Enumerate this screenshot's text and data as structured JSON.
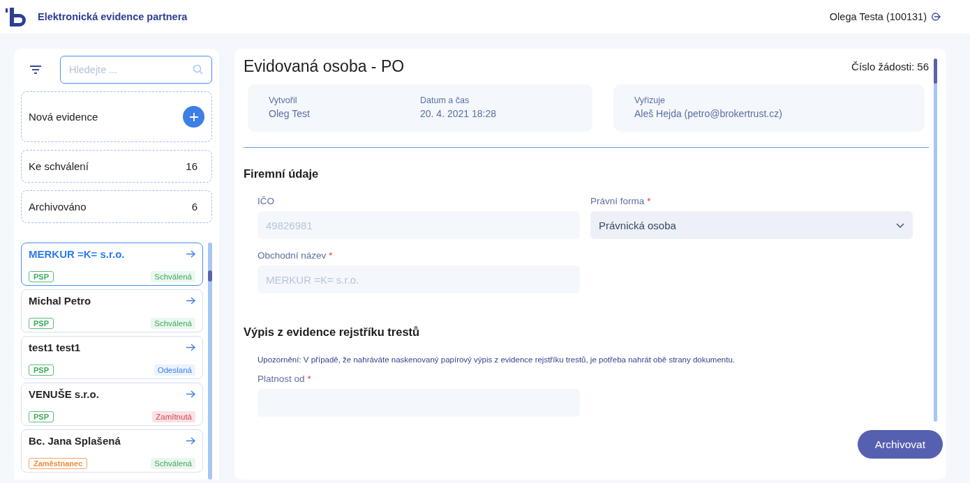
{
  "header": {
    "app_title": "Elektronická evidence partnera",
    "user": "Olega Testa (100131)"
  },
  "sidebar": {
    "search": {
      "placeholder": "Hledejte ..."
    },
    "new_entry": {
      "label": "Nová evidence"
    },
    "counters": [
      {
        "label": "Ke schválení",
        "count": "16"
      },
      {
        "label": "Archivováno",
        "count": "6"
      }
    ],
    "items": [
      {
        "name": "MERKUR =K= s.r.o.",
        "selected": true,
        "tag": {
          "label": "PSP",
          "kind": "psp"
        },
        "status": {
          "label": "Schválená",
          "kind": "approved"
        }
      },
      {
        "name": "Michal Petro",
        "selected": false,
        "tag": {
          "label": "PSP",
          "kind": "psp"
        },
        "status": {
          "label": "Schválená",
          "kind": "approved"
        }
      },
      {
        "name": "test1 test1",
        "selected": false,
        "tag": {
          "label": "PSP",
          "kind": "psp"
        },
        "status": {
          "label": "Odeslaná",
          "kind": "sent"
        }
      },
      {
        "name": "VENUŠE s.r.o.",
        "selected": false,
        "tag": {
          "label": "PSP",
          "kind": "psp"
        },
        "status": {
          "label": "Zamítnutá",
          "kind": "rejected"
        }
      },
      {
        "name": "Bc. Jana Splašená",
        "selected": false,
        "tag": {
          "label": "Zaměstnanec",
          "kind": "employee"
        },
        "status": {
          "label": "Schválená",
          "kind": "approved"
        }
      }
    ]
  },
  "detail": {
    "title": "Evidovaná osoba - PO",
    "request_number": "Číslo žádosti: 56",
    "info_cards": [
      {
        "fields": [
          {
            "label": "Vytvořil",
            "value": "Oleg Test"
          },
          {
            "label": "Datum a čas",
            "value": "20. 4. 2021 18:28"
          }
        ]
      },
      {
        "fields": [
          {
            "label": "Vyřizuje",
            "value": "Aleš Hejda (petro@brokertrust.cz)"
          }
        ]
      }
    ],
    "sections": [
      {
        "title": "Firemní údaje",
        "fields": [
          {
            "label": "IČO",
            "kind": "text",
            "value": "49826981",
            "disabled": true
          },
          {
            "label": "Právní forma",
            "required_mark": "*",
            "kind": "select",
            "value": "Právnická osoba",
            "disabled": false
          },
          {
            "label": "Obchodní název",
            "required_mark": "*",
            "kind": "text",
            "value": "MERKUR =K= s.r.o.",
            "disabled": true
          }
        ]
      },
      {
        "title": "Výpis z evidence rejstříku trestů",
        "note": "Upozornění: V případě, že nahráváte naskenovaný papírový výpis z evidence rejstříku trestů, je potřeba nahrát obě strany dokumentu.",
        "fields": [
          {
            "label": "Platnost od",
            "required_mark": "*",
            "kind": "text"
          }
        ]
      }
    ],
    "archive_button": "Archivovat"
  }
}
